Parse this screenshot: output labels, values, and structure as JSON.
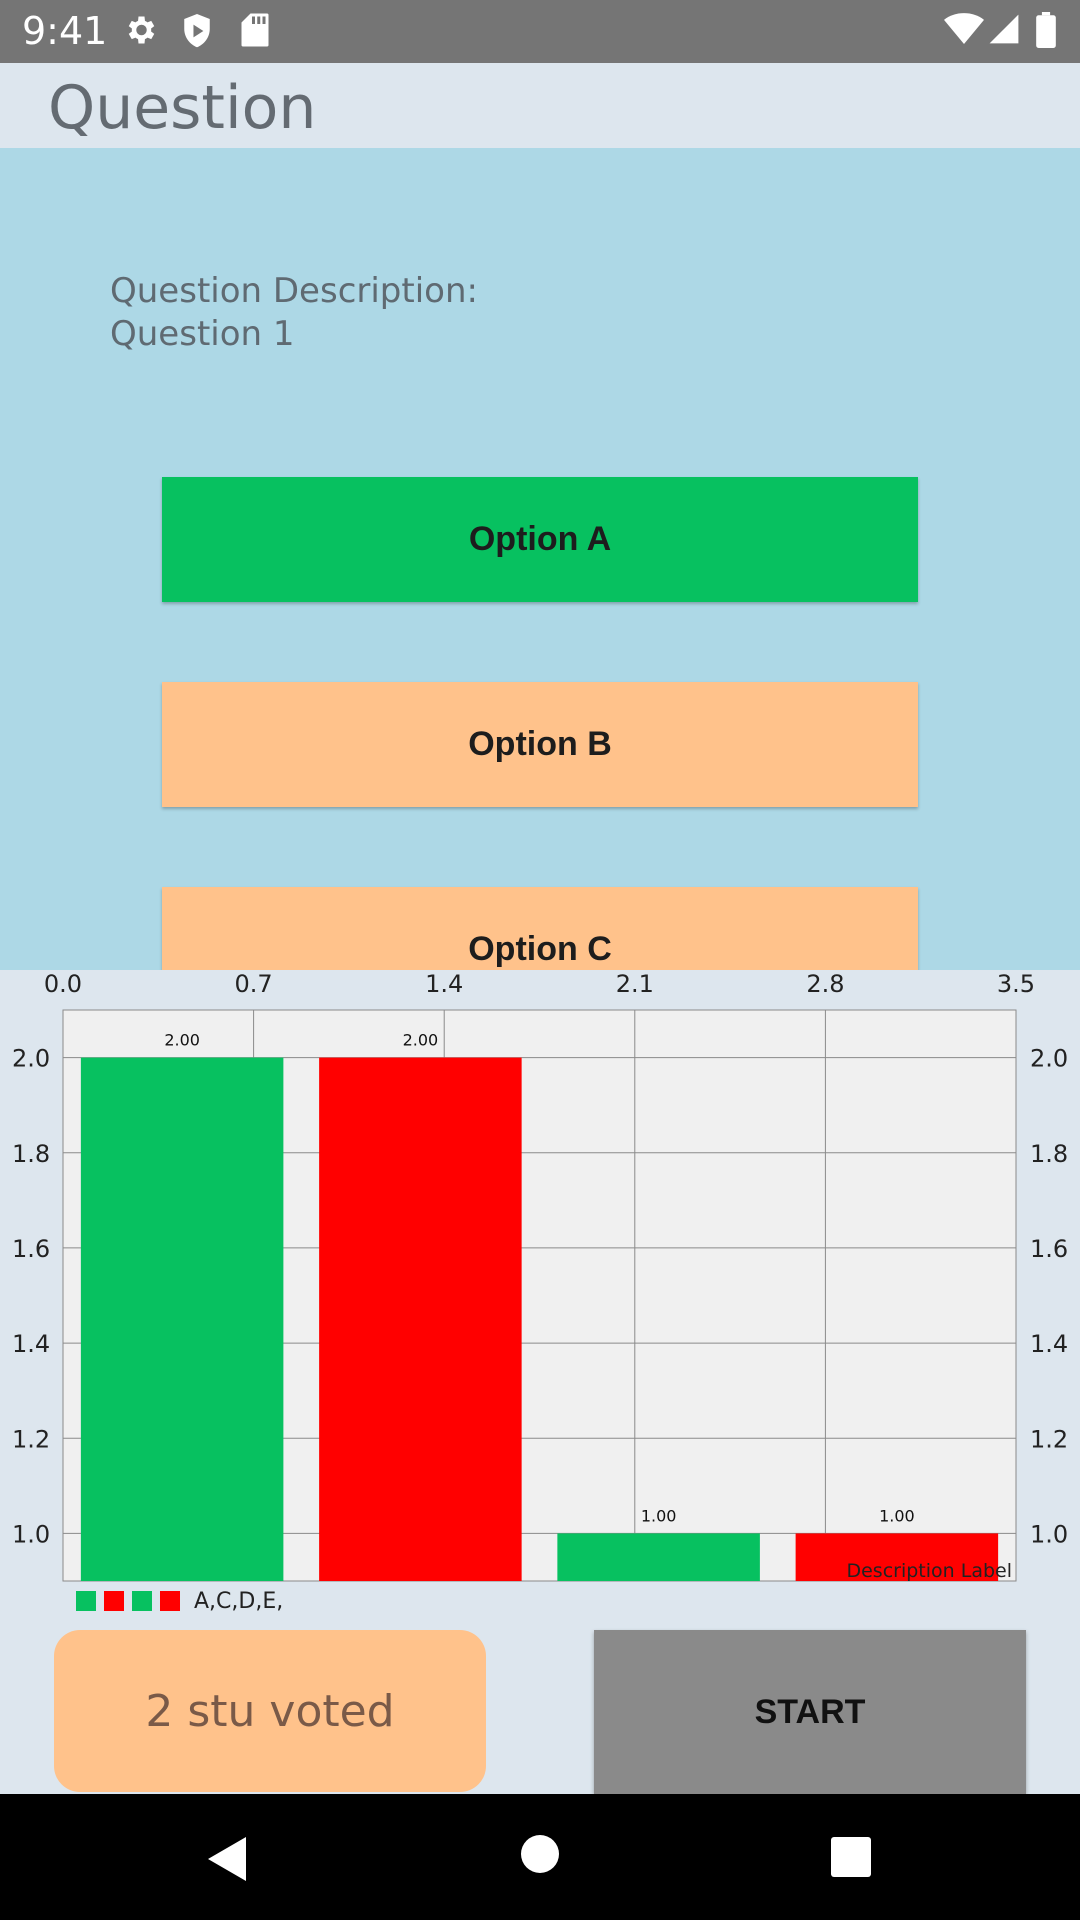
{
  "status_bar": {
    "time": "9:41",
    "icons_left": [
      "gear-icon",
      "shield-icon",
      "sd-card-icon"
    ],
    "icons_right": [
      "wifi-icon",
      "signal-icon",
      "battery-icon"
    ]
  },
  "app_bar": {
    "title": "Question"
  },
  "question": {
    "description_label": "Question Description:",
    "description_text": "Question 1"
  },
  "options": [
    {
      "label": "Option A",
      "color": "#07c160"
    },
    {
      "label": "Option B",
      "color": "#ffc28b"
    },
    {
      "label": "Option C",
      "color": "#ffc28b"
    }
  ],
  "chart_data": {
    "type": "bar",
    "x_top_ticks": [
      "0.0",
      "0.7",
      "1.4",
      "2.1",
      "2.8",
      "3.5"
    ],
    "xlim": [
      0,
      3.5
    ],
    "y_ticks": [
      "1.0",
      "1.2",
      "1.4",
      "1.6",
      "1.8",
      "2.0"
    ],
    "ylim": [
      0.9,
      2.1
    ],
    "bars": [
      {
        "x": 0,
        "value": 2.0,
        "label": "2.00",
        "color": "#07c160"
      },
      {
        "x": 1,
        "value": 2.0,
        "label": "2.00",
        "color": "#ff0000"
      },
      {
        "x": 2,
        "value": 1.0,
        "label": "1.00",
        "color": "#07c160"
      },
      {
        "x": 3,
        "value": 1.0,
        "label": "1.00",
        "color": "#ff0000"
      }
    ],
    "description": "Description Label",
    "grid": true,
    "legend": {
      "colors": [
        "#07c160",
        "#ff0000",
        "#07c160",
        "#ff0000"
      ],
      "text": "A,C,D,E,"
    }
  },
  "footer": {
    "voted_text": "2 stu voted",
    "start_label": "START"
  }
}
